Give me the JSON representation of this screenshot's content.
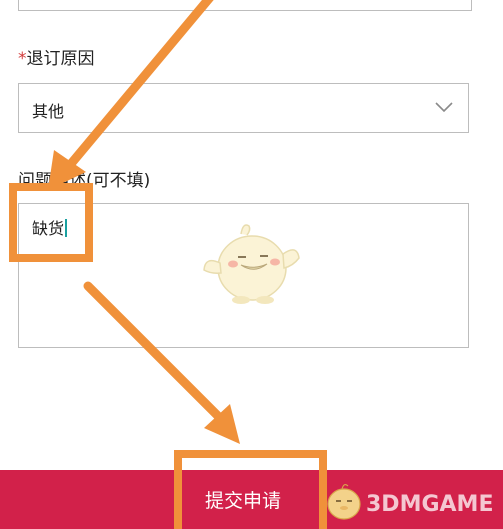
{
  "reason": {
    "required_mark": "*",
    "label": "退订原因",
    "selected": "其他"
  },
  "description": {
    "label": "问题描述(可不填)",
    "value": "缺货"
  },
  "submit": {
    "label": "提交申请"
  },
  "watermark": {
    "text": "3DMGAME"
  },
  "colors": {
    "accent": "#d2214a",
    "annotation": "#f0913a",
    "required": "#d23a3a",
    "border": "#bdbdbd"
  },
  "icons": {
    "dropdown": "chevron-down-icon",
    "mascot": "mascot-illustration"
  }
}
